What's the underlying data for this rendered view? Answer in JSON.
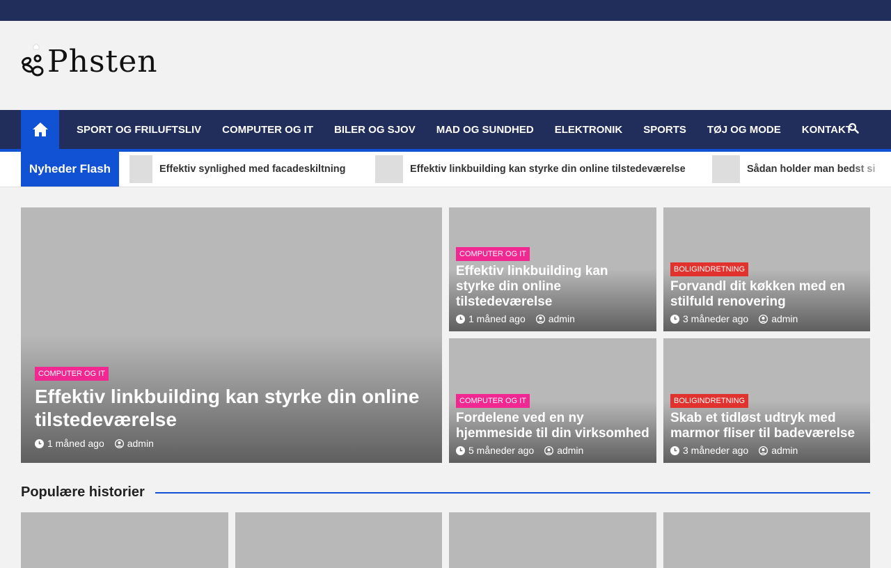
{
  "site": {
    "logo_text": "Phsten"
  },
  "nav": {
    "items": [
      "SPORT OG FRILUFTSLIV",
      "COMPUTER OG IT",
      "BILER OG SJOV",
      "MAD OG SUNDHED",
      "ELEKTRONIK",
      "SPORTS",
      "TØJ OG MODE",
      "KONTAKT"
    ]
  },
  "ticker": {
    "label": "Nyheder Flash",
    "items": [
      "Effektiv synlighed med facadeskiltning",
      "Effektiv linkbuilding kan styrke din online tilstedeværelse",
      "Sådan holder man bedst si"
    ]
  },
  "featured": [
    {
      "category": "COMPUTER OG IT",
      "title": "Effektiv linkbuilding kan styrke din online tilstedeværelse",
      "time": "1 måned ago",
      "author": "admin"
    },
    {
      "category": "COMPUTER OG IT",
      "title": "Effektiv linkbuilding kan styrke din online tilstedeværelse",
      "time": "1 måned ago",
      "author": "admin"
    },
    {
      "category": "BOLIGINDRETNING",
      "title": "Forvandl dit køkken med en stilfuld renovering",
      "time": "3 måneder ago",
      "author": "admin"
    },
    {
      "category": "COMPUTER OG IT",
      "title": "Fordelene ved en ny hjemmeside til din virksomhed",
      "time": "5 måneder ago",
      "author": "admin"
    },
    {
      "category": "BOLIGINDRETNING",
      "title": "Skab et tidløst udtryk med marmor fliser til badeværelse",
      "time": "3 måneder ago",
      "author": "admin"
    }
  ],
  "popular": {
    "heading": "Populære historier"
  },
  "colors": {
    "navy": "#212d5b",
    "accent": "#1151d3",
    "pink": "#f12891",
    "red": "#e1322e"
  }
}
